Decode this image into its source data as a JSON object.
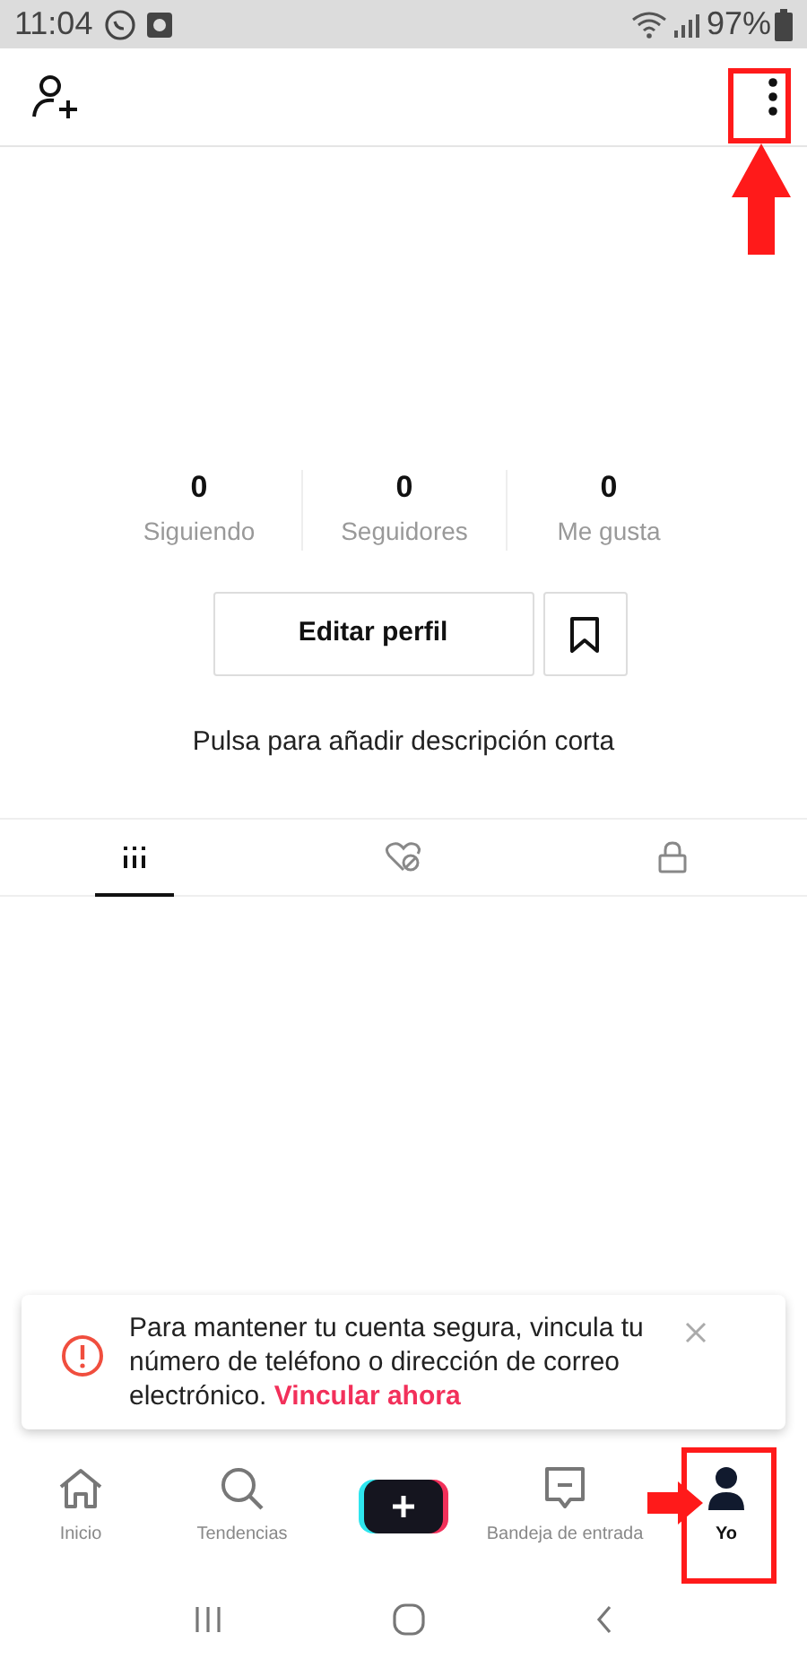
{
  "status_bar": {
    "time": "11:04",
    "battery": "97%"
  },
  "stats": [
    {
      "value": "0",
      "label": "Siguiendo"
    },
    {
      "value": "0",
      "label": "Seguidores"
    },
    {
      "value": "0",
      "label": "Me gusta"
    }
  ],
  "edit_button": "Editar perfil",
  "description_prompt": "Pulsa para añadir descripción corta",
  "profile_tabs": [
    {
      "kind": "videos",
      "selected": true
    },
    {
      "kind": "liked",
      "selected": false
    },
    {
      "kind": "private",
      "selected": false
    }
  ],
  "banner": {
    "message": "Para mantener tu cuenta segura, vincula tu número de teléfono o dirección de correo electrónico.",
    "link": "Vincular ahora"
  },
  "bottom_nav": [
    {
      "kind": "home",
      "label": "Inicio",
      "selected": false
    },
    {
      "kind": "search",
      "label": "Tendencias",
      "selected": false
    },
    {
      "kind": "create",
      "selected": false
    },
    {
      "kind": "inbox",
      "label": "Bandeja de entrada",
      "selected": false
    },
    {
      "kind": "profile",
      "label": "Yo",
      "selected": true
    }
  ]
}
